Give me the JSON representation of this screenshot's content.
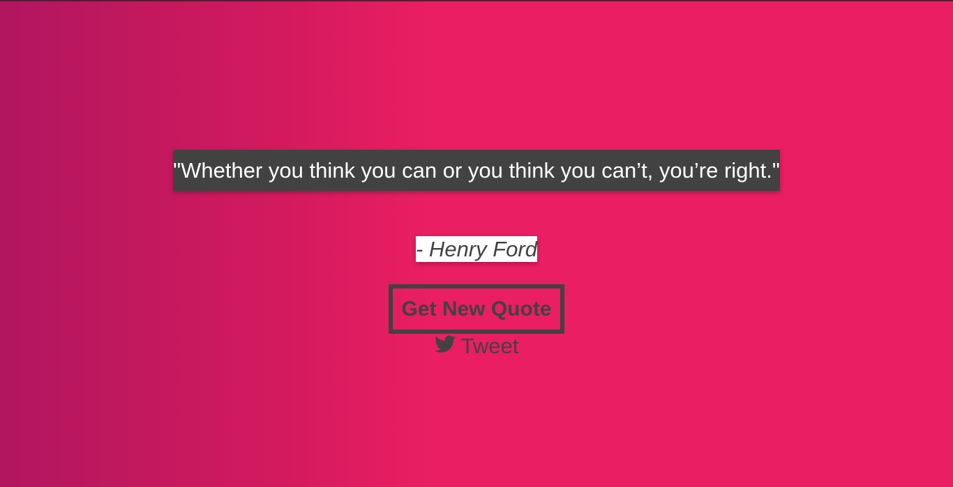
{
  "quote": {
    "text": "\"Whether you think you can or you think you can’t, you’re right.\""
  },
  "author": {
    "text": "- Henry Ford"
  },
  "actions": {
    "new_quote_label": "Get New Quote",
    "tweet_label": "Tweet",
    "tweet_icon": "twitter-bird-icon"
  },
  "colors": {
    "accent": "#ea1e62",
    "gradient_start": "#b1165f",
    "text_dark": "#424242",
    "quote_bg": "#424242",
    "author_bg": "#ffffff"
  }
}
